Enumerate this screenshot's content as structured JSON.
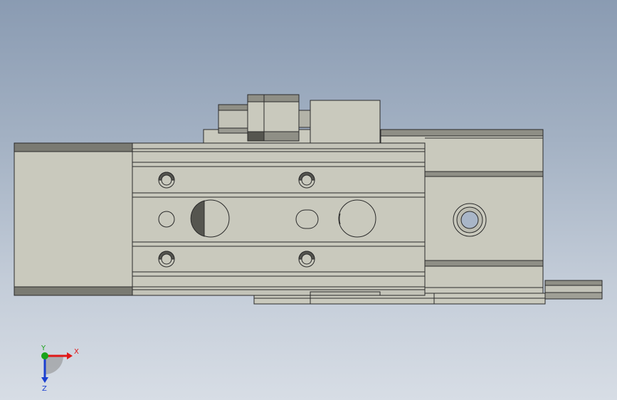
{
  "viewport": {
    "background_top": "#8a9bb2",
    "background_bottom": "#d7dde5",
    "part_color": "#c9c9bd",
    "edge_color": "#2a2a2a",
    "shadow_color": "#7a7a72"
  },
  "triad": {
    "x_label": "X",
    "y_label": "Y",
    "z_label": "Z",
    "x_color": "#e01818",
    "y_color": "#1aa31a",
    "z_color": "#1a3fd0"
  }
}
